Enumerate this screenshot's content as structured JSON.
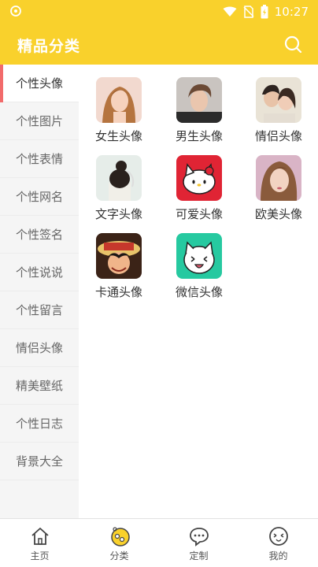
{
  "status": {
    "time": "10:27"
  },
  "header": {
    "title": "精品分类"
  },
  "sidebar": {
    "items": [
      {
        "label": "个性头像"
      },
      {
        "label": "个性图片"
      },
      {
        "label": "个性表情"
      },
      {
        "label": "个性网名"
      },
      {
        "label": "个性签名"
      },
      {
        "label": "个性说说"
      },
      {
        "label": "个性留言"
      },
      {
        "label": "情侣头像"
      },
      {
        "label": "精美壁纸"
      },
      {
        "label": "个性日志"
      },
      {
        "label": "背景大全"
      }
    ],
    "active_index": 0
  },
  "grid": {
    "items": [
      {
        "label": "女生头像"
      },
      {
        "label": "男生头像"
      },
      {
        "label": "情侣头像"
      },
      {
        "label": "文字头像"
      },
      {
        "label": "可爱头像"
      },
      {
        "label": "欧美头像"
      },
      {
        "label": "卡通头像"
      },
      {
        "label": "微信头像"
      }
    ]
  },
  "tabbar": {
    "items": [
      {
        "label": "主页",
        "icon": "home-icon"
      },
      {
        "label": "分类",
        "icon": "category-icon"
      },
      {
        "label": "定制",
        "icon": "chat-icon"
      },
      {
        "label": "我的",
        "icon": "profile-icon"
      }
    ],
    "active_index": 1
  },
  "colors": {
    "accent": "#f9d12c",
    "active_marker": "#f26b6b"
  }
}
